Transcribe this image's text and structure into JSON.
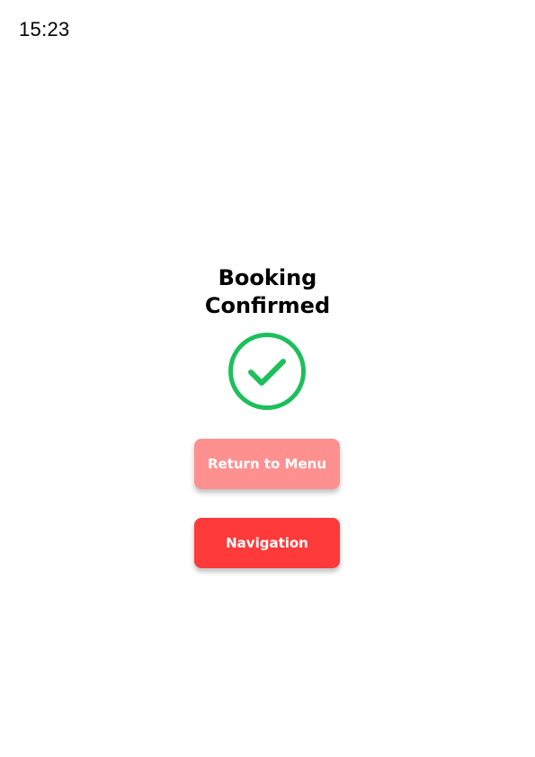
{
  "status_bar": {
    "time": "15:23"
  },
  "confirmation": {
    "title_line1": "Booking",
    "title_line2": "Confirmed",
    "icon": "check-circle-icon",
    "icon_color": "#1dbf5b"
  },
  "actions": {
    "return_label": "Return to Menu",
    "return_color": "#ff9090",
    "navigation_label": "Navigation",
    "navigation_color": "#ff3a3a"
  }
}
